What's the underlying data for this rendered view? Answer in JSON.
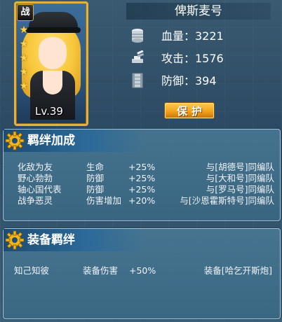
{
  "ship": {
    "name": "俾斯麦号",
    "type_badge": "战",
    "stars": 5,
    "level": "Lv.39"
  },
  "stats": [
    {
      "icon": "fuel-barrels-icon",
      "label": "血量：3221"
    },
    {
      "icon": "cannon-icon",
      "label": "攻击：1576"
    },
    {
      "icon": "armor-plate-icon",
      "label": "防御：394"
    }
  ],
  "protect_button": "保护",
  "bond_panel": {
    "title": "羁绊加成",
    "rows": [
      {
        "name": "化敌为友",
        "stat": "生命",
        "bonus": "+25%",
        "condition": "与[胡德号]同编队"
      },
      {
        "name": "野心勃勃",
        "stat": "防御",
        "bonus": "+25%",
        "condition": "与[大和号]同编队"
      },
      {
        "name": "轴心国代表",
        "stat": "防御",
        "bonus": "+25%",
        "condition": "与[罗马号]同编队"
      },
      {
        "name": "战争恶灵",
        "stat": "伤害增加",
        "bonus": "+20%",
        "condition": "与[沙恩霍斯特号]同编队"
      }
    ]
  },
  "equip_panel": {
    "title": "装备羁绊",
    "row": {
      "name": "知己知彼",
      "stat": "装备伤害",
      "bonus": "+50%",
      "condition": "装备[哈乞开斯炮]"
    }
  },
  "colors": {
    "frame_gold": "#e2b23d",
    "button_orange": "#f3a21b",
    "panel_blue": "#4a7a96",
    "header_blue": "#1d4c73"
  }
}
